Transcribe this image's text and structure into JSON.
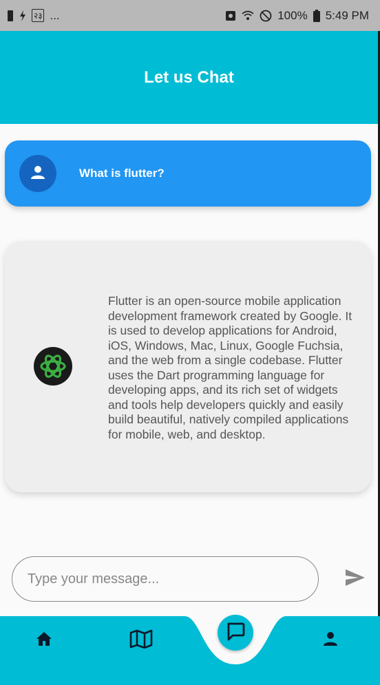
{
  "status_bar": {
    "left_glyph": "२३",
    "left_more": "...",
    "battery": "100%",
    "time": "5:49 PM",
    "icons": [
      "phone-icon",
      "charging-icon",
      "image-icon",
      "data-saver-icon",
      "wifi-call-icon",
      "dnd-icon",
      "battery-icon"
    ]
  },
  "app_bar": {
    "title": "Let us Chat"
  },
  "messages": [
    {
      "role": "user",
      "icon": "person-icon",
      "text": "What is flutter?"
    },
    {
      "role": "bot",
      "icon": "openai-logo-icon",
      "text": "Flutter is an open-source mobile application development framework created by Google. It is used to develop applications for Android, iOS, Windows, Mac, Linux, Google Fuchsia, and the web from a single codebase. Flutter uses the Dart programming language for developing apps, and its rich set of widgets and tools help developers quickly and easily build beautiful, natively compiled applications for mobile, web, and desktop."
    }
  ],
  "composer": {
    "placeholder": "Type your message...",
    "value": "",
    "send_icon": "send-icon"
  },
  "bottom_nav": {
    "items": [
      "home-icon",
      "map-icon",
      "chat-icon",
      "profile-icon"
    ],
    "selected": "chat-icon"
  },
  "colors": {
    "app_bar": "#00bcd4",
    "user_bubble": "#2196f3",
    "bot_bubble": "#eeeeee",
    "background": "#fafafa"
  }
}
